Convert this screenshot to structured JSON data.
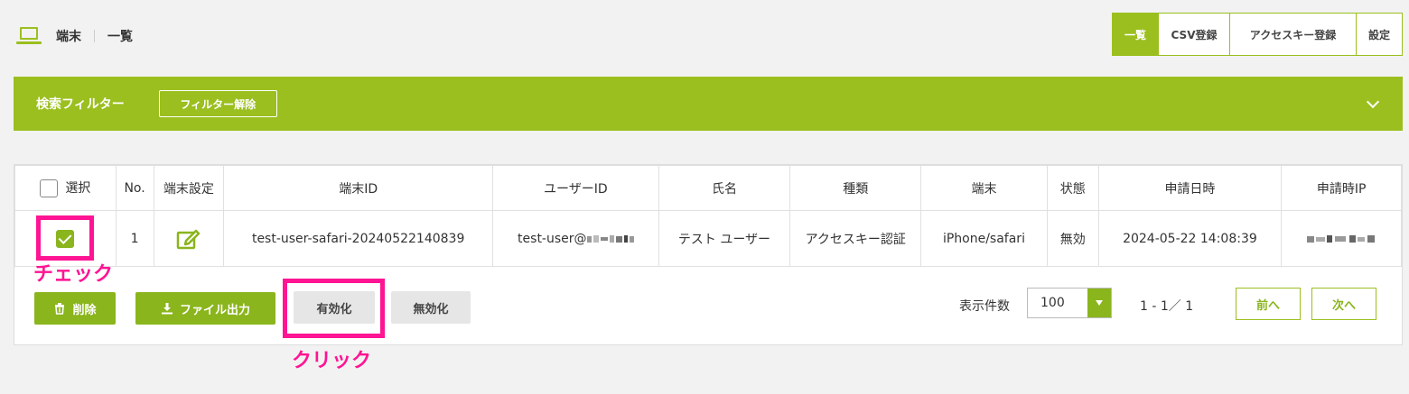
{
  "header": {
    "section": "端末",
    "page": "一覧"
  },
  "topnav": [
    "一覧",
    "CSV登録",
    "アクセスキー登録",
    "設定"
  ],
  "filter": {
    "title": "検索フィルター",
    "clear_label": "フィルター解除"
  },
  "table": {
    "columns": [
      "選択",
      "No.",
      "端末設定",
      "端末ID",
      "ユーザーID",
      "氏名",
      "種類",
      "端末",
      "状態",
      "申請日時",
      "申請時IP"
    ],
    "rows": [
      {
        "no": "1",
        "device_id": "test-user-safari-20240522140839",
        "user_id": "test-user@",
        "name": "テスト ユーザー",
        "type": "アクセスキー認証",
        "device": "iPhone/safari",
        "status": "無効",
        "applied_at": "2024-05-22 14:08:39"
      }
    ]
  },
  "actions": {
    "delete": "削除",
    "export": "ファイル出力",
    "enable": "有効化",
    "disable": "無効化"
  },
  "pagination": {
    "per_page_label": "表示件数",
    "per_page": "100",
    "range": "1 - 1／ 1",
    "prev": "前へ",
    "next": "次へ"
  },
  "annotations": {
    "check": "チェック",
    "click": "クリック"
  },
  "colors": {
    "accent": "#9bbf1f",
    "highlight": "#ff1493"
  }
}
